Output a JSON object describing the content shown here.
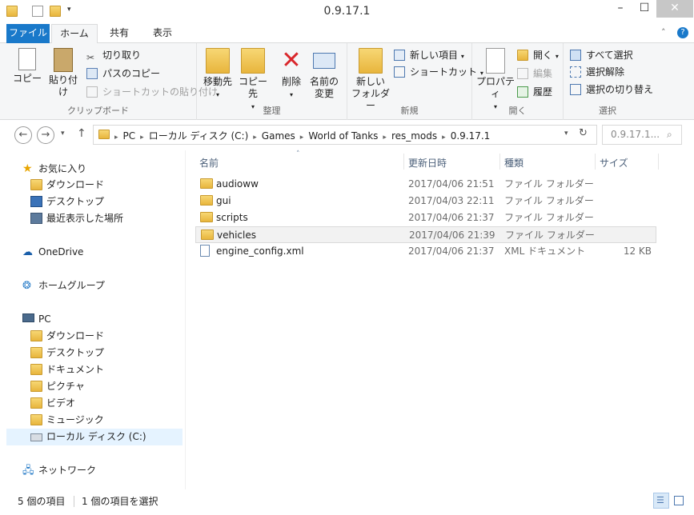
{
  "window": {
    "title": "0.9.17.1"
  },
  "tabs": [
    "ファイル",
    "ホーム",
    "共有",
    "表示"
  ],
  "ribbon": {
    "clipboard": {
      "copy": "コピー",
      "paste": "貼り付け",
      "cut": "切り取り",
      "copy_path": "パスのコピー",
      "paste_shortcut": "ショートカットの貼り付け",
      "label": "クリップボード"
    },
    "organize": {
      "move_to": "移動先",
      "copy_to": "コピー先",
      "delete": "削除",
      "rename_line1": "名前の",
      "rename_line2": "変更",
      "label": "整理"
    },
    "new": {
      "new_folder_line1": "新しい",
      "new_folder_line2": "フォルダー",
      "new_item": "新しい項目",
      "easy_access": "ショートカット",
      "label": "新規"
    },
    "open": {
      "properties": "プロパティ",
      "open": "開く",
      "edit": "編集",
      "history": "履歴",
      "label": "開く"
    },
    "select": {
      "select_all": "すべて選択",
      "select_none": "選択解除",
      "invert": "選択の切り替え",
      "label": "選択"
    }
  },
  "address": {
    "crumbs": [
      "PC",
      "ローカル ディスク (C:)",
      "Games",
      "World of Tanks",
      "res_mods",
      "0.9.17.1"
    ],
    "search_placeholder": "0.9.17.1..."
  },
  "navpane": {
    "favorites": "お気に入り",
    "fav_items": [
      "ダウンロード",
      "デスクトップ",
      "最近表示した場所"
    ],
    "onedrive": "OneDrive",
    "homegroup": "ホームグループ",
    "pc": "PC",
    "pc_items": [
      "ダウンロード",
      "デスクトップ",
      "ドキュメント",
      "ピクチャ",
      "ビデオ",
      "ミュージック",
      "ローカル ディスク (C:)"
    ],
    "network": "ネットワーク"
  },
  "columns": {
    "name": "名前",
    "date": "更新日時",
    "type": "種類",
    "size": "サイズ"
  },
  "files": [
    {
      "name": "audioww",
      "date": "2017/04/06 21:51",
      "type": "ファイル フォルダー",
      "size": ""
    },
    {
      "name": "gui",
      "date": "2017/04/03 22:11",
      "type": "ファイル フォルダー",
      "size": ""
    },
    {
      "name": "scripts",
      "date": "2017/04/06 21:37",
      "type": "ファイル フォルダー",
      "size": ""
    },
    {
      "name": "vehicles",
      "date": "2017/04/06 21:39",
      "type": "ファイル フォルダー",
      "size": ""
    },
    {
      "name": "engine_config.xml",
      "date": "2017/04/06 21:37",
      "type": "XML ドキュメント",
      "size": "12 KB"
    }
  ],
  "status": {
    "count": "5 個の項目",
    "selected": "1 個の項目を選択"
  },
  "colors": {
    "accent": "#1979ca",
    "folder": "#f0c75a"
  }
}
